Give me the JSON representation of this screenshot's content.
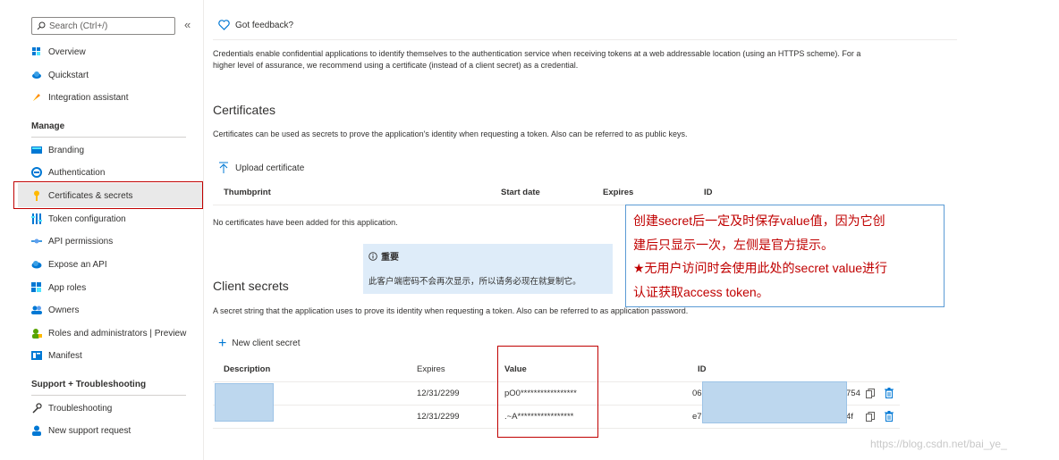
{
  "sidebar": {
    "search_placeholder": "Search (Ctrl+/)",
    "collapse": "«",
    "top_items": [
      {
        "label": "Overview",
        "icon": "overview-grid-icon"
      },
      {
        "label": "Quickstart",
        "icon": "cloud-quickstart-icon"
      },
      {
        "label": "Integration assistant",
        "icon": "rocket-icon"
      }
    ],
    "manage_title": "Manage",
    "manage_items": [
      {
        "label": "Branding",
        "icon": "branding-icon"
      },
      {
        "label": "Authentication",
        "icon": "authentication-icon"
      },
      {
        "label": "Certificates & secrets",
        "icon": "key-icon"
      },
      {
        "label": "Token configuration",
        "icon": "token-config-icon"
      },
      {
        "label": "API permissions",
        "icon": "api-permissions-icon"
      },
      {
        "label": "Expose an API",
        "icon": "cloud-api-icon"
      },
      {
        "label": "App roles",
        "icon": "app-roles-icon"
      },
      {
        "label": "Owners",
        "icon": "owners-icon"
      },
      {
        "label": "Roles and administrators | Preview",
        "icon": "roles-admin-icon"
      },
      {
        "label": "Manifest",
        "icon": "manifest-icon"
      }
    ],
    "support_title": "Support + Troubleshooting",
    "support_items": [
      {
        "label": "Troubleshooting",
        "icon": "wrench-icon"
      },
      {
        "label": "New support request",
        "icon": "support-person-icon"
      }
    ]
  },
  "main": {
    "feedback": "Got feedback?",
    "intro": "Credentials enable confidential applications to identify themselves to the authentication service when receiving tokens at a web addressable location (using an HTTPS scheme). For a higher level of assurance, we recommend using a certificate (instead of a client secret) as a credential.",
    "certificates": {
      "title": "Certificates",
      "desc": "Certificates can be used as secrets to prove the application's identity when requesting a token. Also can be referred to as public keys.",
      "upload": "Upload certificate",
      "columns": [
        "Thumbprint",
        "Start date",
        "Expires",
        "ID"
      ],
      "empty": "No certificates have been added for this application."
    },
    "important": {
      "title": "重要",
      "body": "此客户端密码不会再次显示，所以请务必现在就复制它。"
    },
    "client_secrets": {
      "title": "Client secrets",
      "desc": "A secret string that the application uses to prove its identity when requesting a token. Also can be referred to as application password.",
      "new": "New client secret",
      "columns": [
        "Description",
        "Expires",
        "Value",
        "ID"
      ],
      "rows": [
        {
          "expires": "12/31/2299",
          "value": "pO0*****************",
          "id_start": "06",
          "id_end": "754"
        },
        {
          "expires": "12/31/2299",
          "value": ".~A*****************",
          "id_start": "e7",
          "id_end": "4f"
        }
      ]
    }
  },
  "annotation": {
    "line1": "创建secret后一定及时保存value值，因为它创",
    "line2": "建后只显示一次，左侧是官方提示。",
    "line3": "★无用户访问时会使用此处的secret value进行",
    "line4": "认证获取access token。"
  },
  "watermark": "https://blog.csdn.net/bai_ye_"
}
